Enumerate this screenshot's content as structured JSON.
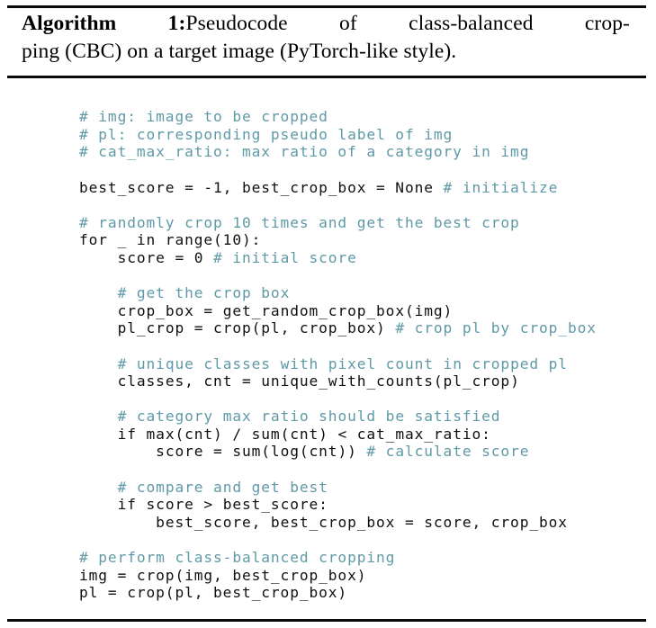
{
  "figure": {
    "caption": {
      "label": "Algorithm 1:",
      "text_line_1": "Pseudocode of class-balanced crop-",
      "text_line_2": "ping (CBC) on a target image (PyTorch-like style).",
      "full_text": "Algorithm 1: Pseudocode of class-balanced cropping (CBC) on a target image (PyTorch-like style)."
    },
    "rules": {
      "top": "solid-black-rule",
      "middle": "solid-black-rule",
      "bottom": "solid-black-rule"
    },
    "colors": {
      "comment": "#5f9aa6",
      "code": "#101010",
      "rule": "#0a0a0a",
      "background": "#ffffff"
    },
    "language": "python",
    "code_lines": [
      {
        "indent": 0,
        "comment": "# img: image to be cropped",
        "code": ""
      },
      {
        "indent": 0,
        "comment": "# pl: corresponding pseudo label of img",
        "code": ""
      },
      {
        "indent": 0,
        "comment": "# cat_max_ratio: max ratio of a category in img",
        "code": ""
      },
      {
        "indent": 0,
        "comment": "",
        "code": ""
      },
      {
        "indent": 0,
        "comment": " # initialize",
        "code": "best_score = -1, best_crop_box = None"
      },
      {
        "indent": 0,
        "comment": "",
        "code": ""
      },
      {
        "indent": 0,
        "comment": "# randomly crop 10 times and get the best crop",
        "code": ""
      },
      {
        "indent": 0,
        "comment": "",
        "code": "for _ in range(10):"
      },
      {
        "indent": 4,
        "comment": " # initial score",
        "code": "score = 0"
      },
      {
        "indent": 0,
        "comment": "",
        "code": ""
      },
      {
        "indent": 4,
        "comment": "# get the crop box",
        "code": ""
      },
      {
        "indent": 4,
        "comment": "",
        "code": "crop_box = get_random_crop_box(img)"
      },
      {
        "indent": 4,
        "comment": " # crop pl by crop_box",
        "code": "pl_crop = crop(pl, crop_box)"
      },
      {
        "indent": 0,
        "comment": "",
        "code": ""
      },
      {
        "indent": 4,
        "comment": "# unique classes with pixel count in cropped pl",
        "code": ""
      },
      {
        "indent": 4,
        "comment": "",
        "code": "classes, cnt = unique_with_counts(pl_crop)"
      },
      {
        "indent": 0,
        "comment": "",
        "code": ""
      },
      {
        "indent": 4,
        "comment": "# category max ratio should be satisfied",
        "code": ""
      },
      {
        "indent": 4,
        "comment": "",
        "code": "if max(cnt) / sum(cnt) < cat_max_ratio:"
      },
      {
        "indent": 8,
        "comment": " # calculate score",
        "code": "score = sum(log(cnt))"
      },
      {
        "indent": 0,
        "comment": "",
        "code": ""
      },
      {
        "indent": 4,
        "comment": "# compare and get best",
        "code": ""
      },
      {
        "indent": 4,
        "comment": "",
        "code": "if score > best_score:"
      },
      {
        "indent": 8,
        "comment": "",
        "code": "best_score, best_crop_box = score, crop_box"
      },
      {
        "indent": 0,
        "comment": "",
        "code": ""
      },
      {
        "indent": 0,
        "comment": "# perform class-balanced cropping",
        "code": ""
      },
      {
        "indent": 0,
        "comment": "",
        "code": "img = crop(img, best_crop_box)"
      },
      {
        "indent": 0,
        "comment": "",
        "code": "pl = crop(pl, best_crop_box)"
      }
    ]
  }
}
